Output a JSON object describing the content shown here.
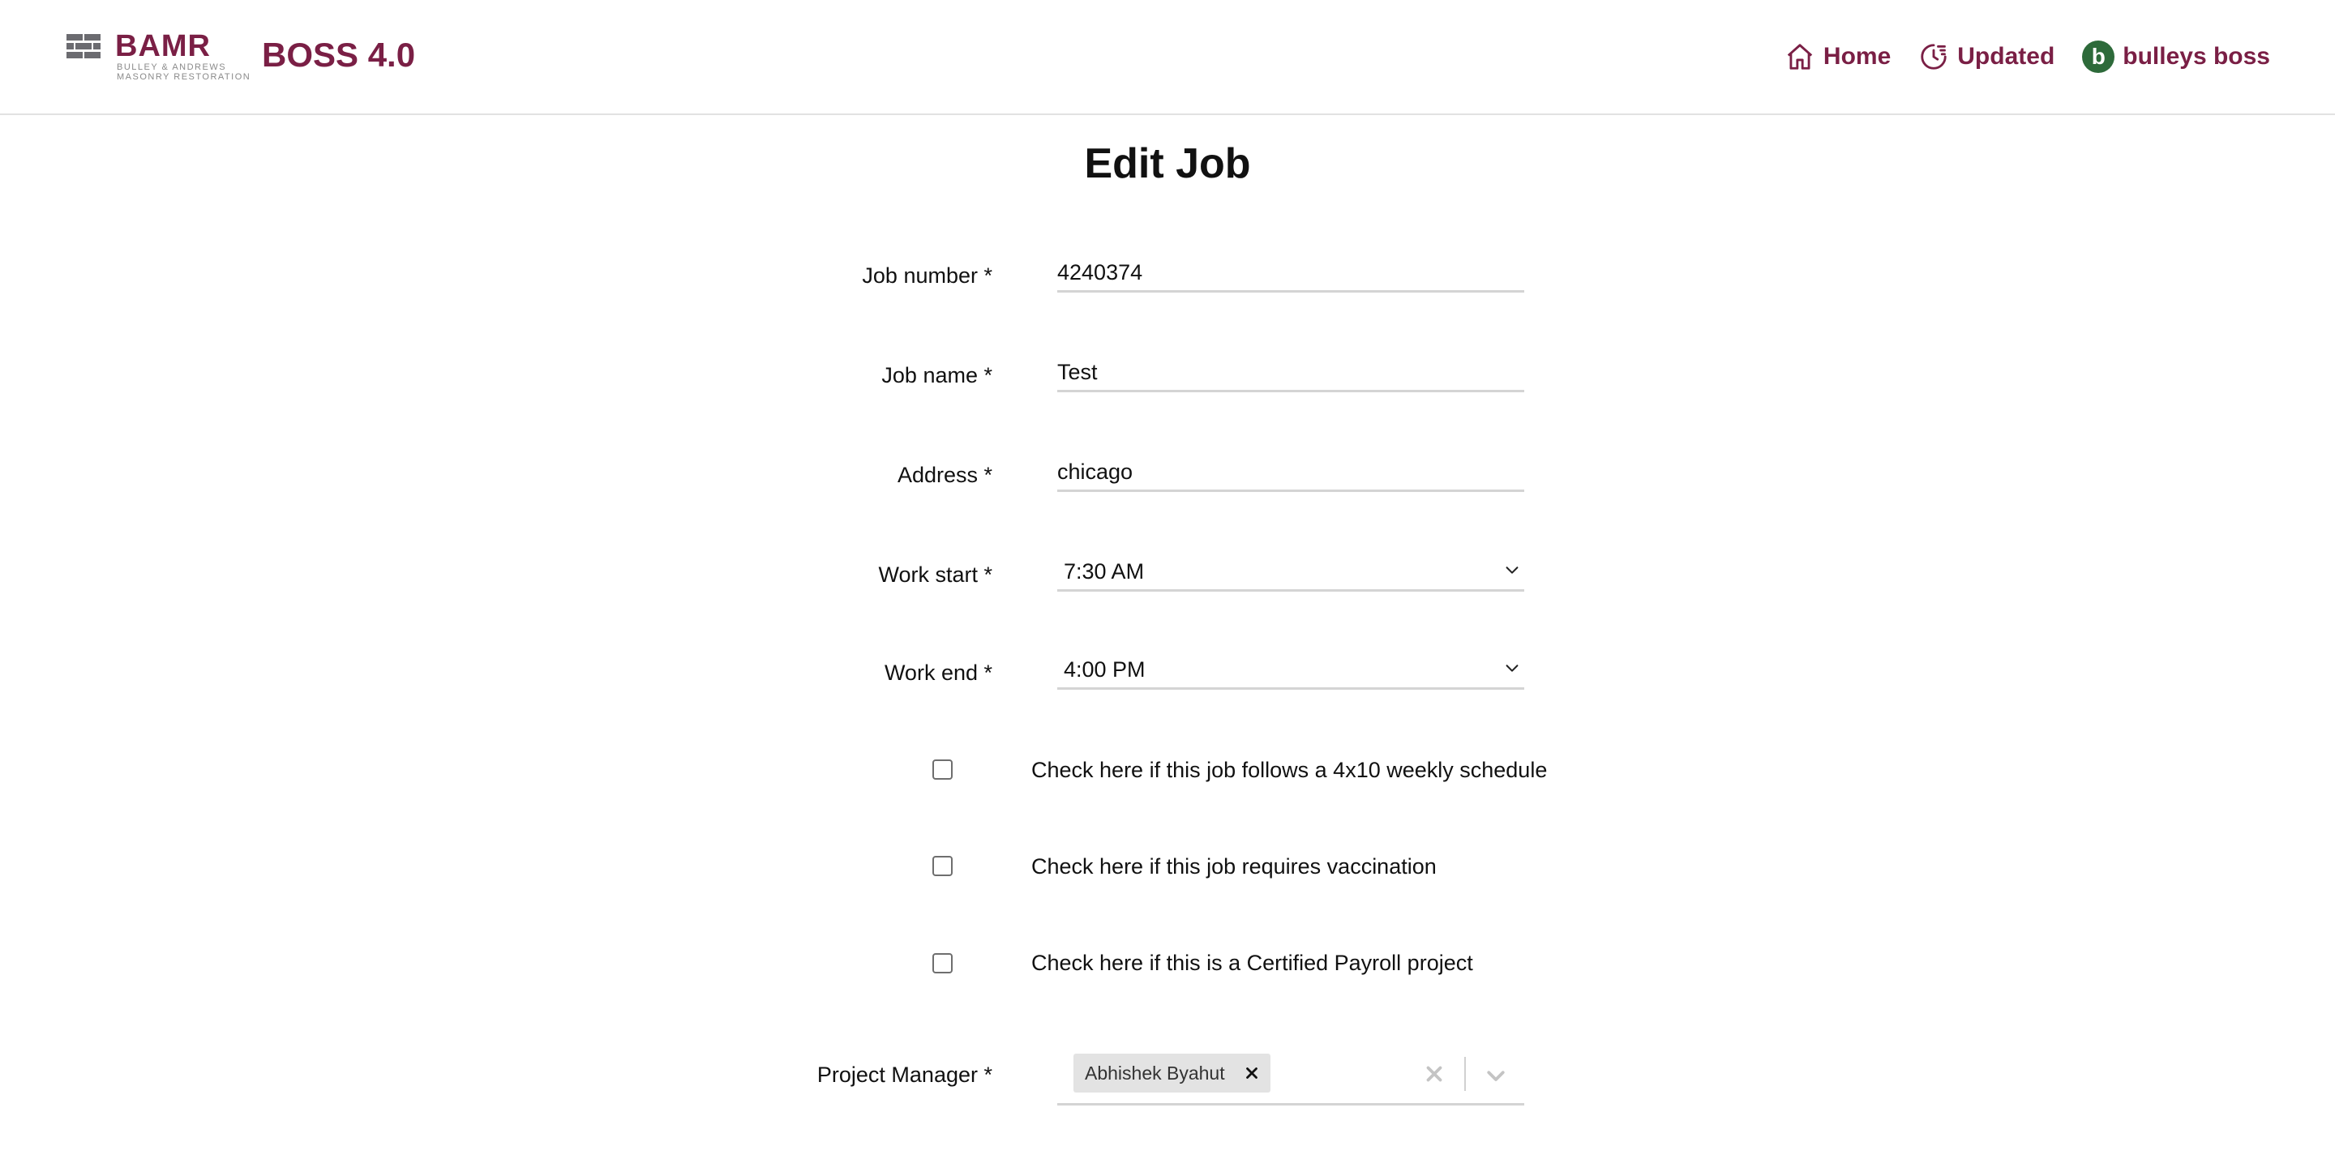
{
  "brand": {
    "logo_word": "BAMR",
    "logo_sub_line1": "BULLEY & ANDREWS",
    "logo_sub_line2": "MASONRY RESTORATION",
    "app_name": "BOSS 4.0",
    "accent_color": "#7a1f45"
  },
  "nav": {
    "home_label": "Home",
    "home_icon": "home-icon",
    "updated_label": "Updated",
    "updated_icon": "clock-history-icon",
    "user_initial": "b",
    "user_name": "bulleys boss",
    "avatar_color": "#2d6a3a"
  },
  "page": {
    "title": "Edit Job"
  },
  "form": {
    "job_number": {
      "label": "Job number *",
      "value": "4240374"
    },
    "job_name": {
      "label": "Job name *",
      "value": "Test"
    },
    "address": {
      "label": "Address *",
      "value": "chicago"
    },
    "work_start": {
      "label": "Work start *",
      "value": "7:30 AM"
    },
    "work_end": {
      "label": "Work end *",
      "value": "4:00 PM"
    },
    "checkboxes": [
      {
        "label": "Check here if this job follows a 4x10 weekly schedule",
        "checked": false
      },
      {
        "label": "Check here if this job requires vaccination",
        "checked": false
      },
      {
        "label": "Check here if this is a Certified Payroll project",
        "checked": false
      }
    ],
    "project_manager": {
      "label": "Project Manager *",
      "selected": "Abhishek Byahut"
    }
  }
}
